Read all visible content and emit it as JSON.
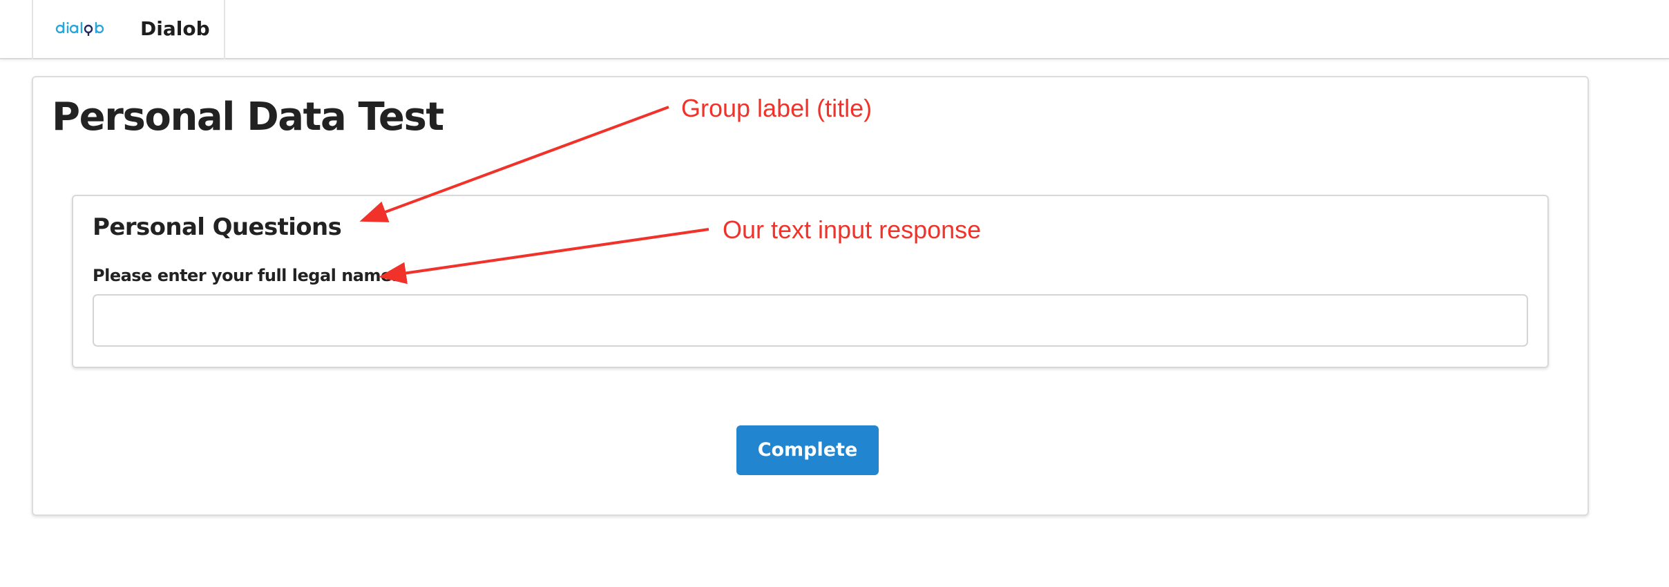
{
  "header": {
    "logo_text": "dialob",
    "app_name": "Dialob"
  },
  "form": {
    "title": "Personal Data Test",
    "group": {
      "title": "Personal Questions",
      "question_label": "Please enter your full legal name.",
      "input_value": ""
    },
    "complete_label": "Complete"
  },
  "annotations": {
    "group_label": "Group label (title)",
    "text_input": "Our text input response"
  },
  "colors": {
    "primary_button": "#2185d0",
    "annotation": "#f0322a",
    "logo": "#29a6dc",
    "logo_accent": "#1e2a5e"
  }
}
